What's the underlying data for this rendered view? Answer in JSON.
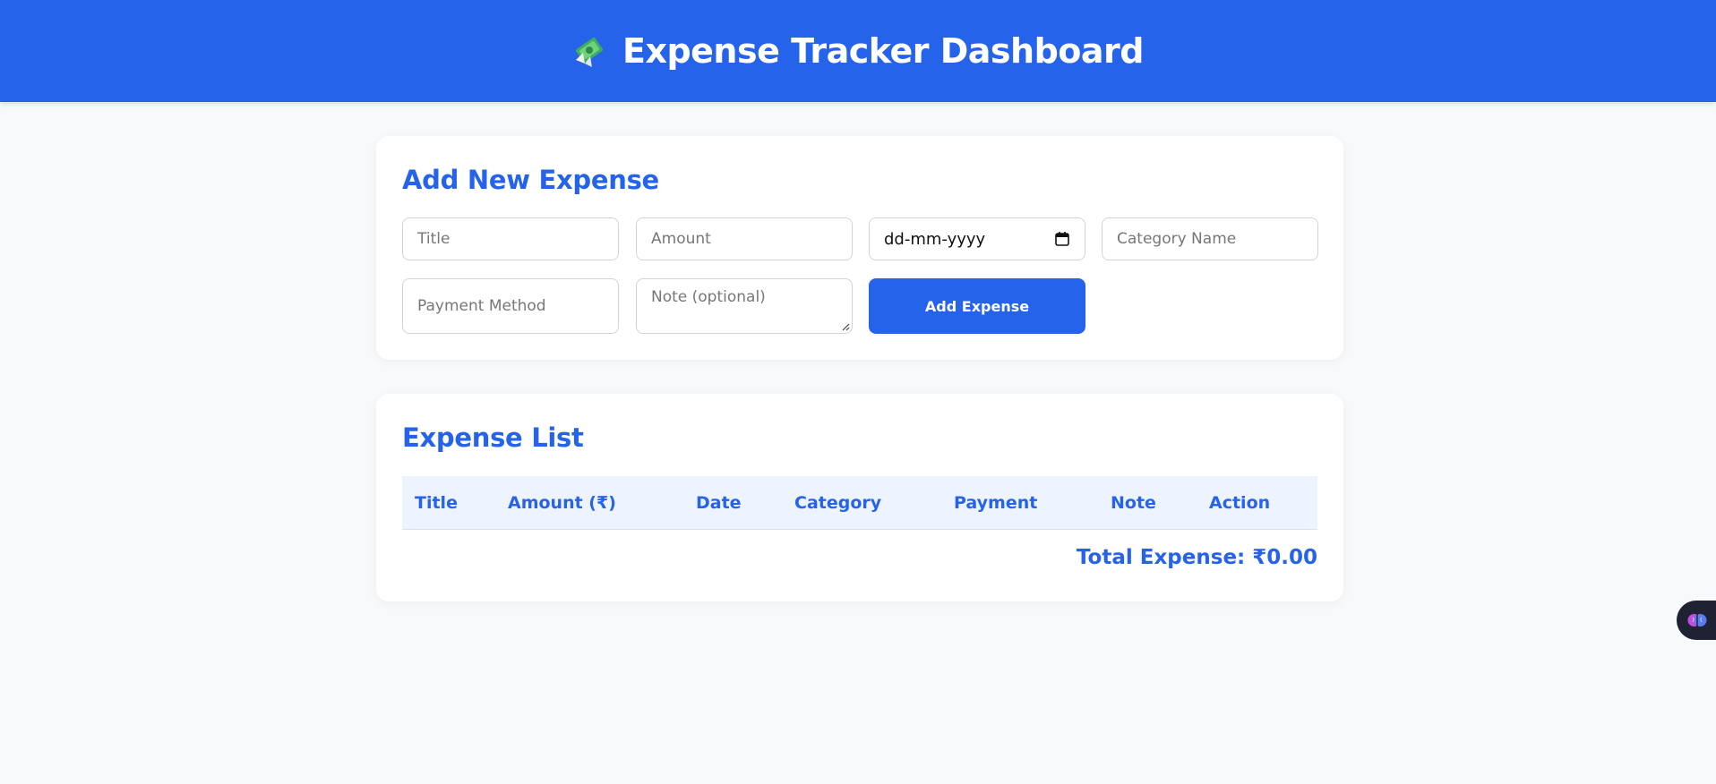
{
  "header": {
    "title": "Expense Tracker Dashboard",
    "icon": "money-with-wings-icon",
    "background": "#2563eb"
  },
  "form": {
    "heading": "Add New Expense",
    "title_placeholder": "Title",
    "amount_placeholder": "Amount",
    "date_placeholder": "dd-mm-yyyy",
    "category_placeholder": "Category Name",
    "payment_placeholder": "Payment Method",
    "note_placeholder": "Note (optional)",
    "submit_label": "Add Expense"
  },
  "list": {
    "heading": "Expense List",
    "columns": [
      "Title",
      "Amount (₹)",
      "Date",
      "Category",
      "Payment",
      "Note",
      "Action"
    ],
    "rows": [],
    "total_label": "Total Expense: ₹0.00"
  },
  "floating_widget": {
    "icon": "brain-icon"
  },
  "colors": {
    "accent": "#2563eb",
    "page_bg": "#f8f9fb",
    "table_head_bg": "#eef4ff"
  }
}
